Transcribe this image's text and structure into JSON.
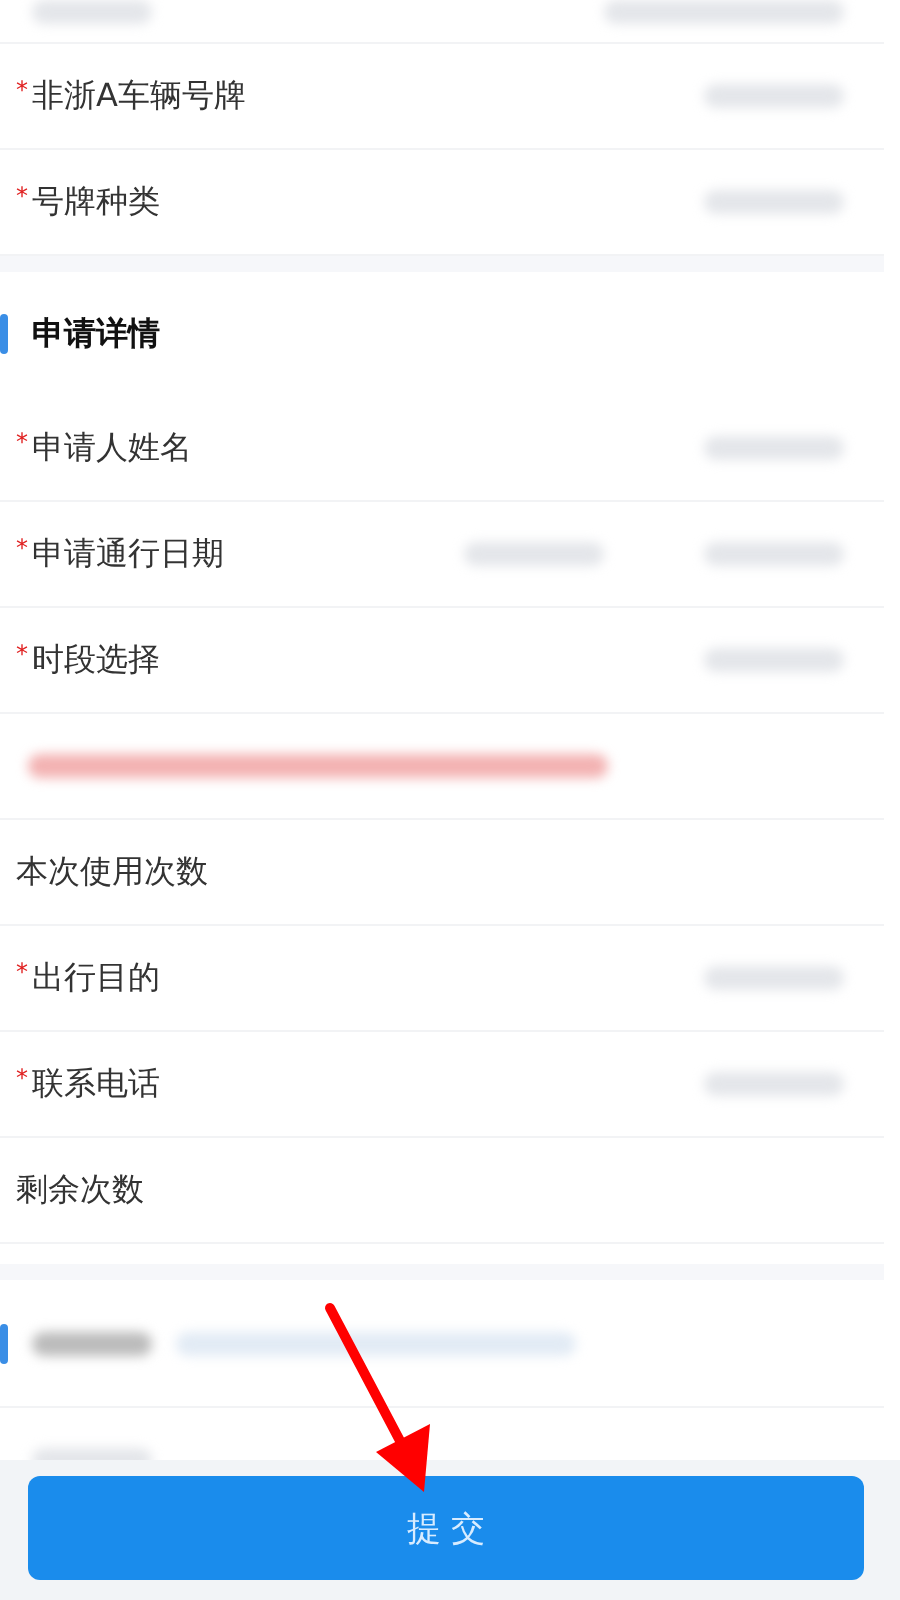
{
  "rows": [
    {
      "kind": "partial"
    },
    {
      "kind": "field",
      "required_mark": "*",
      "label": "非浙A车辆号牌",
      "value_blurred": true
    },
    {
      "kind": "field",
      "required_mark": "*",
      "label": "号牌种类",
      "value_blurred": true
    },
    {
      "kind": "section",
      "label": "申请详情"
    },
    {
      "kind": "field",
      "required_mark": "*",
      "label": "申请人姓名",
      "value_blurred": true
    },
    {
      "kind": "range_field",
      "required_mark": "*",
      "label": "申请通行日期",
      "value_blurred": true
    },
    {
      "kind": "field",
      "required_mark": "*",
      "label": "时段选择",
      "value_blurred": true
    },
    {
      "kind": "notice"
    },
    {
      "kind": "field",
      "label": "本次使用次数",
      "value_blurred": false
    },
    {
      "kind": "field",
      "required_mark": "*",
      "label": "出行目的",
      "value_blurred": true
    },
    {
      "kind": "field",
      "required_mark": "*",
      "label": "联系电话",
      "value_blurred": true
    },
    {
      "kind": "field",
      "label": "剩余次数",
      "value_blurred": false
    },
    {
      "kind": "blurred_section"
    },
    {
      "kind": "blurred_row"
    }
  ],
  "submit_button": "提 交",
  "annotation_arrow": true
}
